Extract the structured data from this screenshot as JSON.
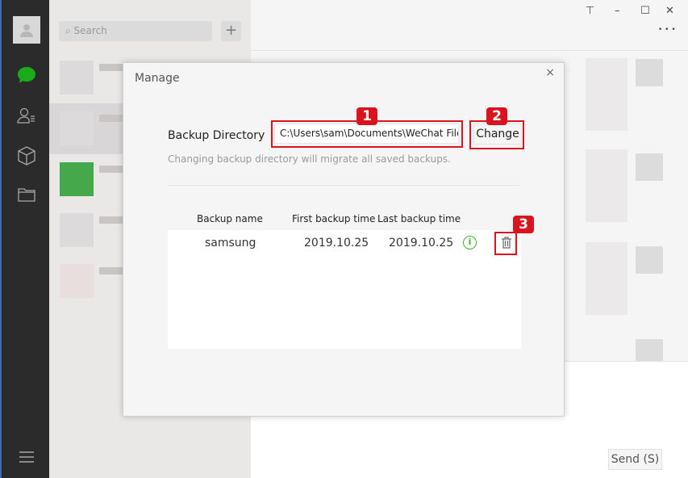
{
  "sidebar": {
    "icons": [
      "avatar",
      "chat-icon",
      "contacts-icon",
      "box-icon",
      "folder-icon",
      "menu-icon"
    ]
  },
  "list": {
    "search_placeholder": "Search",
    "add_label": "+"
  },
  "window": {
    "pin": "⊤",
    "minimize": "–",
    "maximize": "☐",
    "close": "✕",
    "more": "• • •"
  },
  "chat": {
    "send_label": "Send (S)"
  },
  "dialog": {
    "title": "Manage",
    "close": "×",
    "backup_dir_label": "Backup Directory",
    "backup_dir_value": "C:\\Users\\sam\\Documents\\WeChat Files",
    "change_label": "Change",
    "hint": "Changing backup directory will migrate all saved backups.",
    "columns": [
      "Backup name",
      "First backup time",
      "Last backup time"
    ],
    "rows": [
      {
        "name": "samsung",
        "first": "2019.10.25",
        "last": "2019.10.25"
      }
    ],
    "badges": [
      "1",
      "2",
      "3"
    ],
    "highlight_color": "#d9141e",
    "info_color": "#3cb034"
  }
}
